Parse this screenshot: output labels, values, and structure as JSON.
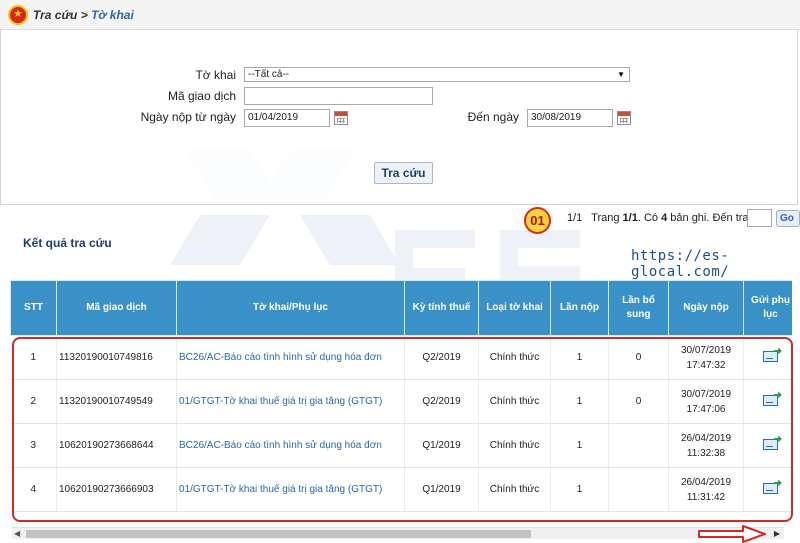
{
  "header": {
    "crumb_root": "Tra cứu",
    "crumb_sep": ">",
    "crumb_current": "Tờ khai"
  },
  "icons": [
    "emblem-icon",
    "calendar-icon",
    "send-appendix-icon",
    "scroll-left-icon",
    "scroll-right-icon",
    "pointer-arrow-icon"
  ],
  "colors": {
    "table_header": "#3a91c8",
    "link": "#2a66b1",
    "highlight": "#d32a26",
    "badge_fill": "#f8d33a"
  },
  "search": {
    "to_khai_label": "Tờ khai",
    "to_khai_value": "--Tất cả--",
    "ma_gd_label": "Mã giao dịch",
    "ma_gd_value": "",
    "from_label": "Ngày nộp từ ngày",
    "from_value": "01/04/2019",
    "to_label": "Đến ngày",
    "to_value": "30/08/2019",
    "button_label": "Tra cứu"
  },
  "badge": "01",
  "paging": {
    "page_word": "Trang",
    "page": "1/1",
    "records_prefix": ". Có",
    "records": "4",
    "records_suffix": "bản ghi. Đến trang",
    "go_label": "Go"
  },
  "results_title": "Kết quả tra cứu",
  "site_url": "https://es-glocal.com/",
  "table": {
    "headers": [
      "STT",
      "Mã giao dịch",
      "Tờ khai/Phụ lục",
      "Kỳ tính thuế",
      "Loại tờ khai",
      "Lần nộp",
      "Lần bổ sung",
      "Ngày nộp",
      "Gửi phụ lục"
    ],
    "rows": [
      {
        "stt": "1",
        "ma_gd": "11320190010749816",
        "to_khai": "BC26/AC-Báo cáo tình hình sử dụng hóa đơn",
        "ky": "Q2/2019",
        "loai": "Chính thức",
        "lan_nop": "1",
        "lan_bs": "0",
        "ngay": "30/07/2019",
        "gio": "17:47:32"
      },
      {
        "stt": "2",
        "ma_gd": "11320190010749549",
        "to_khai": "01/GTGT-Tờ khai thuế giá trị gia tăng (GTGT)",
        "ky": "Q2/2019",
        "loai": "Chính thức",
        "lan_nop": "1",
        "lan_bs": "0",
        "ngay": "30/07/2019",
        "gio": "17:47:06"
      },
      {
        "stt": "3",
        "ma_gd": "10620190273668644",
        "to_khai": "BC26/AC-Báo cáo tình hình sử dụng hóa đơn",
        "ky": "Q1/2019",
        "loai": "Chính thức",
        "lan_nop": "1",
        "lan_bs": "",
        "ngay": "26/04/2019",
        "gio": "11:32:38"
      },
      {
        "stt": "4",
        "ma_gd": "10620190273666903",
        "to_khai": "01/GTGT-Tờ khai thuế giá trị gia tăng (GTGT)",
        "ky": "Q1/2019",
        "loai": "Chính thức",
        "lan_nop": "1",
        "lan_bs": "",
        "ngay": "26/04/2019",
        "gio": "11:31:42"
      }
    ]
  }
}
